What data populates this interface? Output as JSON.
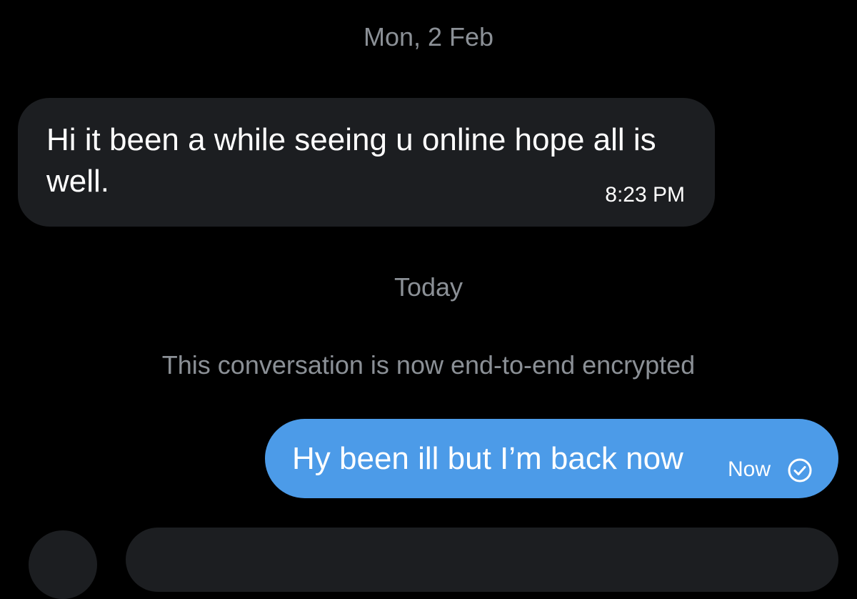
{
  "conversation": {
    "date_separator_1": "Mon, 2 Feb",
    "date_separator_2": "Today",
    "system_notice": "This conversation is now end-to-end encrypted",
    "messages": [
      {
        "direction": "incoming",
        "text": "Hi it been a while  seeing  u online hope all is well.",
        "time": "8:23 PM"
      },
      {
        "direction": "outgoing",
        "text": "Hy been ill but I’m back now",
        "time": "Now",
        "status_icon": "sent-check-icon"
      }
    ]
  },
  "colors": {
    "background": "#000000",
    "incoming_bubble": "#1c1e21",
    "outgoing_bubble": "#4c9be8",
    "muted_text": "#8b9096",
    "text": "#ffffff"
  }
}
